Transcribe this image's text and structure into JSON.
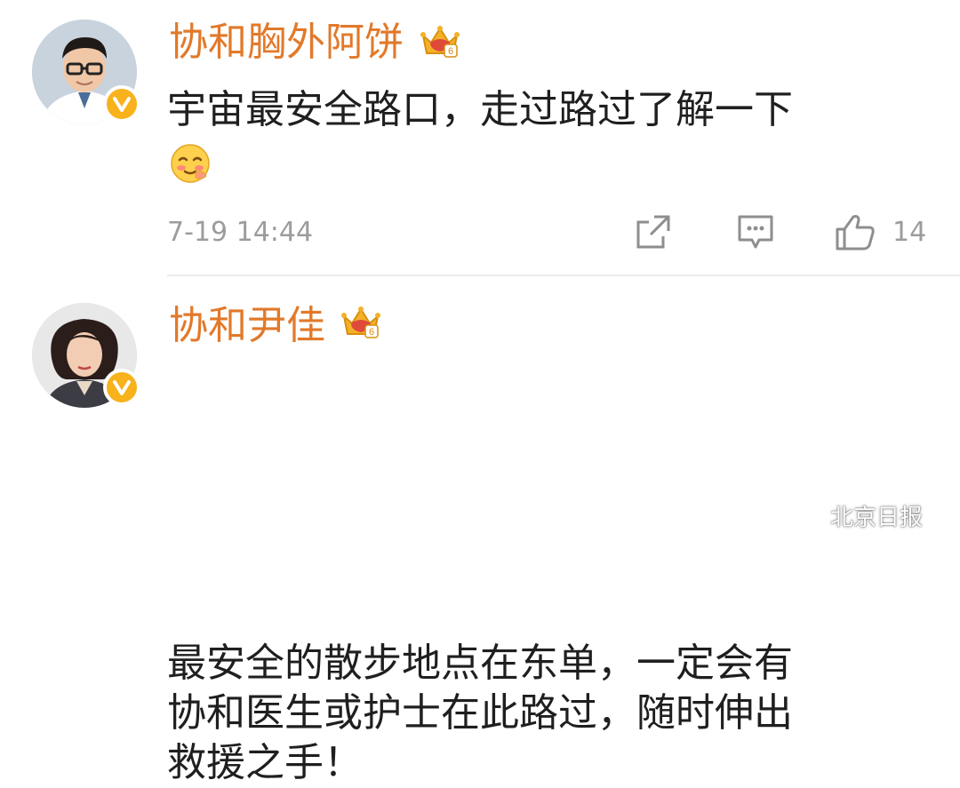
{
  "comments": [
    {
      "username": "协和胸外阿饼",
      "text": "宇宙最安全路口，走过路过了解一下",
      "emoji": "blushing-face",
      "time": "7-19 14:44",
      "actions": {
        "share_icon": "share-icon",
        "reply_icon": "comment-icon",
        "like_icon": "thumbs-up-icon",
        "like_count": "14"
      }
    },
    {
      "username": "协和尹佳",
      "text_lines": [
        "最安全的散步地点在东单，一定会有",
        "协和医生或护士在此路过，随时伸出",
        "救援之手！"
      ]
    }
  ],
  "watermark": {
    "text": "北京日报"
  },
  "colors": {
    "username": "#e2792a",
    "verified_badge": "#f7b21c",
    "meta": "#9c9c9c",
    "divider": "#ededed"
  }
}
